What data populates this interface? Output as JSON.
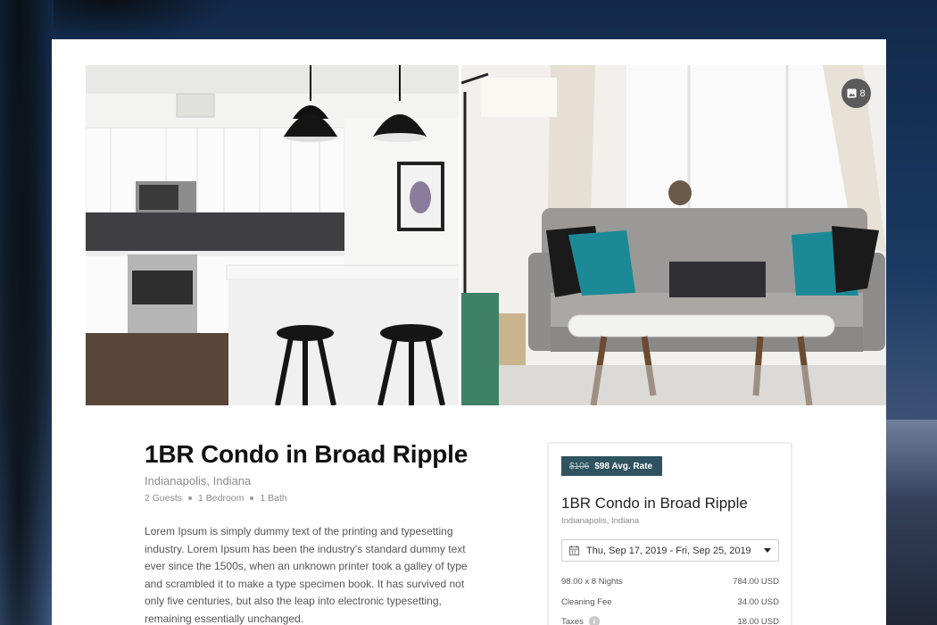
{
  "listing": {
    "title": "1BR Condo in Broad Ripple",
    "location": "Indianapolis, Indiana",
    "specs": [
      "2 Guests",
      "1 Bedroom",
      "1 Bath"
    ],
    "description": "Lorem Ipsum is simply dummy text of the printing and typesetting industry. Lorem Ipsum has been the industry's standard dummy text ever since the 1500s, when an unknown printer took a galley of type and scrambled it to make a type specimen book. It has survived not only five centuries, but also the leap into electronic typesetting, remaining essentially unchanged."
  },
  "gallery": {
    "photo_count": "8",
    "count_icon": "image-icon",
    "photos": [
      "kitchen-photo",
      "living-room-photo"
    ]
  },
  "booking": {
    "old_rate": "$106",
    "avg_rate": "$98 Avg. Rate",
    "title": "1BR Condo in Broad Ripple",
    "location": "Indianapolis, Indiana",
    "date_range": "Thu, Sep 17, 2019 - Fri, Sep 25, 2019",
    "fees": [
      {
        "label": "98.00 x 8 Nights",
        "amount": "784.00 USD"
      },
      {
        "label": "Cleaning Fee",
        "amount": "34.00 USD"
      },
      {
        "label": "Taxes",
        "amount": "18.00 USD"
      }
    ]
  },
  "colors": {
    "badge_bg": "#2f5360",
    "card_bg": "#ffffff",
    "page_bg": "#1b3a63"
  }
}
